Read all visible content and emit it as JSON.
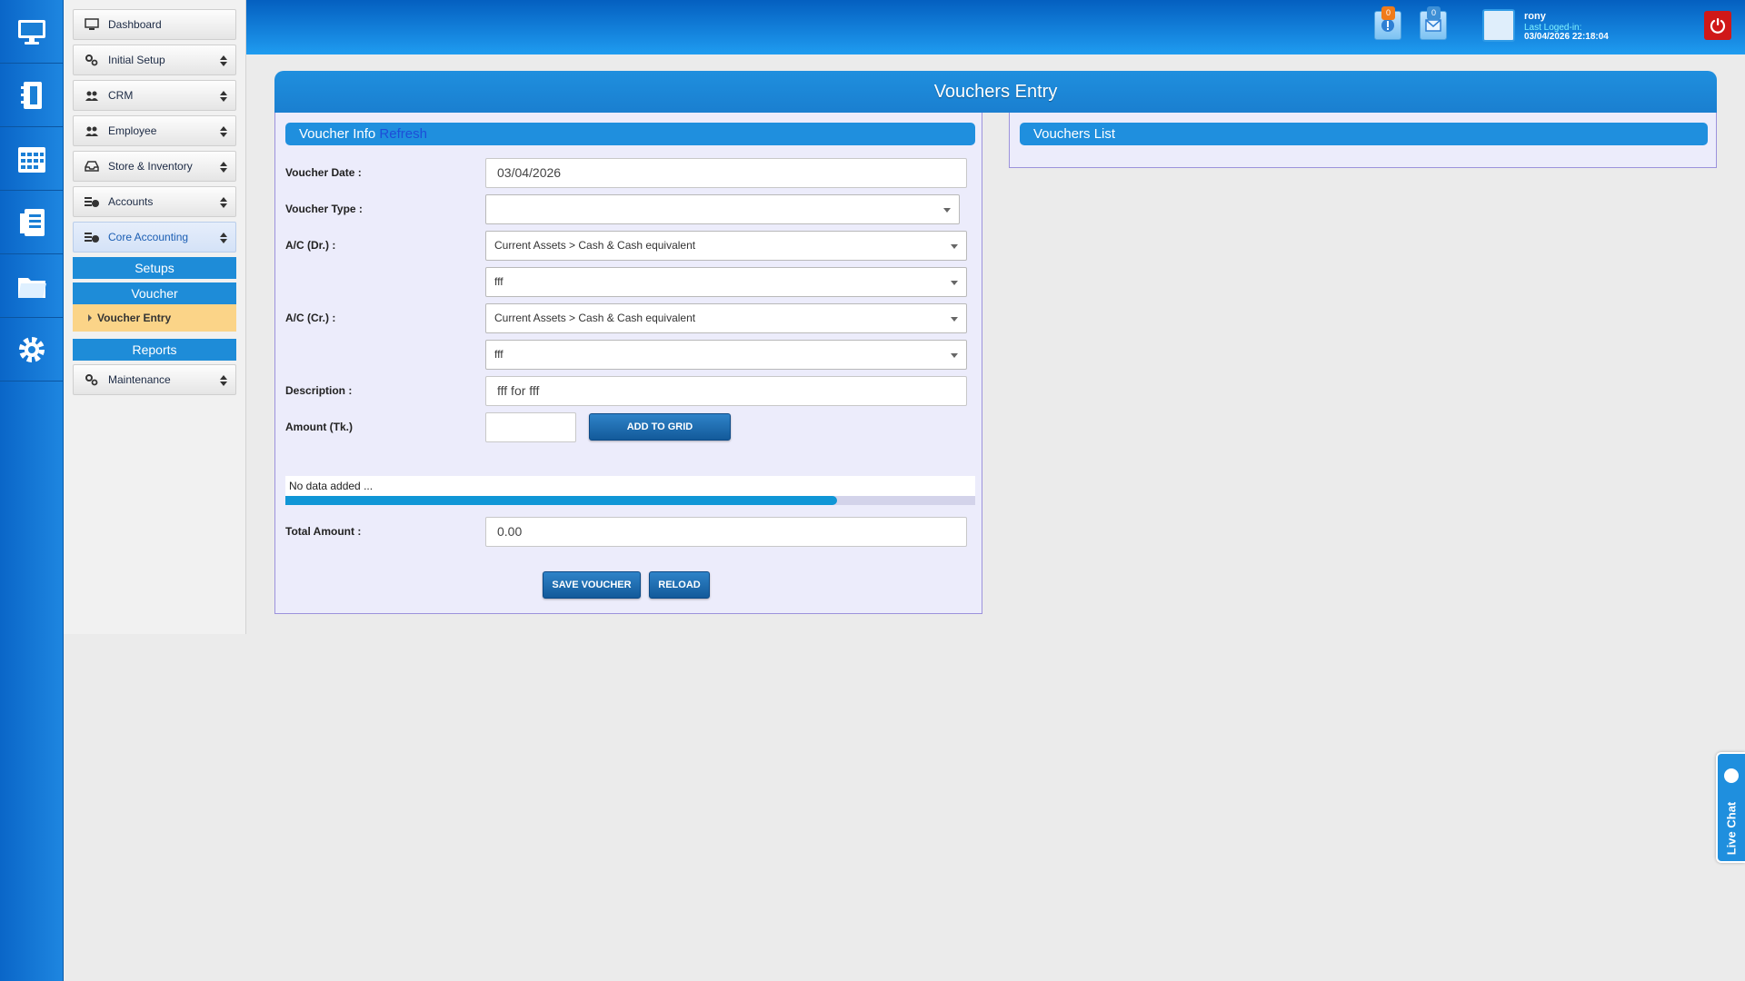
{
  "menu": {
    "items": [
      {
        "label": "Dashboard"
      },
      {
        "label": "Initial Setup"
      },
      {
        "label": "CRM"
      },
      {
        "label": "Employee"
      },
      {
        "label": "Store & Inventory"
      },
      {
        "label": "Accounts"
      },
      {
        "label": "Core Accounting"
      }
    ],
    "sections": {
      "setups": "Setups",
      "voucher": "Voucher",
      "voucher_entry": "Voucher Entry",
      "reports": "Reports"
    },
    "maintenance": "Maintenance"
  },
  "header": {
    "notifications_count": "0",
    "messages_count": "0",
    "user_name": "rony",
    "last_login_label": "Last Loged-in:",
    "last_login_time": "03/04/2026 22:18:04"
  },
  "page": {
    "title": "Vouchers Entry"
  },
  "voucher_info": {
    "header": "Voucher Info",
    "refresh": "Refresh",
    "labels": {
      "date": "Voucher Date :",
      "type": "Voucher Type :",
      "dr": "A/C (Dr.) :",
      "cr": "A/C (Cr.) :",
      "description": "Description :",
      "amount": "Amount (Tk.)",
      "total": "Total Amount :"
    },
    "values": {
      "date": "03/04/2026",
      "type": "",
      "dr_account": "Current Assets > Cash & Cash equivalent",
      "dr_sub": "fff",
      "cr_account": "Current Assets > Cash & Cash equivalent",
      "cr_sub": "fff",
      "description": "fff for fff",
      "amount": "",
      "total": "0.00"
    },
    "add_to_grid": "ADD TO GRID",
    "grid_empty": "No data added ...",
    "progress": 0.8,
    "save": "SAVE VOUCHER",
    "reload": "RELOAD"
  },
  "vouchers_list": {
    "header": "Vouchers List"
  },
  "live_chat": "Live Chat",
  "colors": {
    "primary": "#1f8fde",
    "button": "#135a9a",
    "highlight": "#fbd488",
    "power": "#d01818"
  }
}
